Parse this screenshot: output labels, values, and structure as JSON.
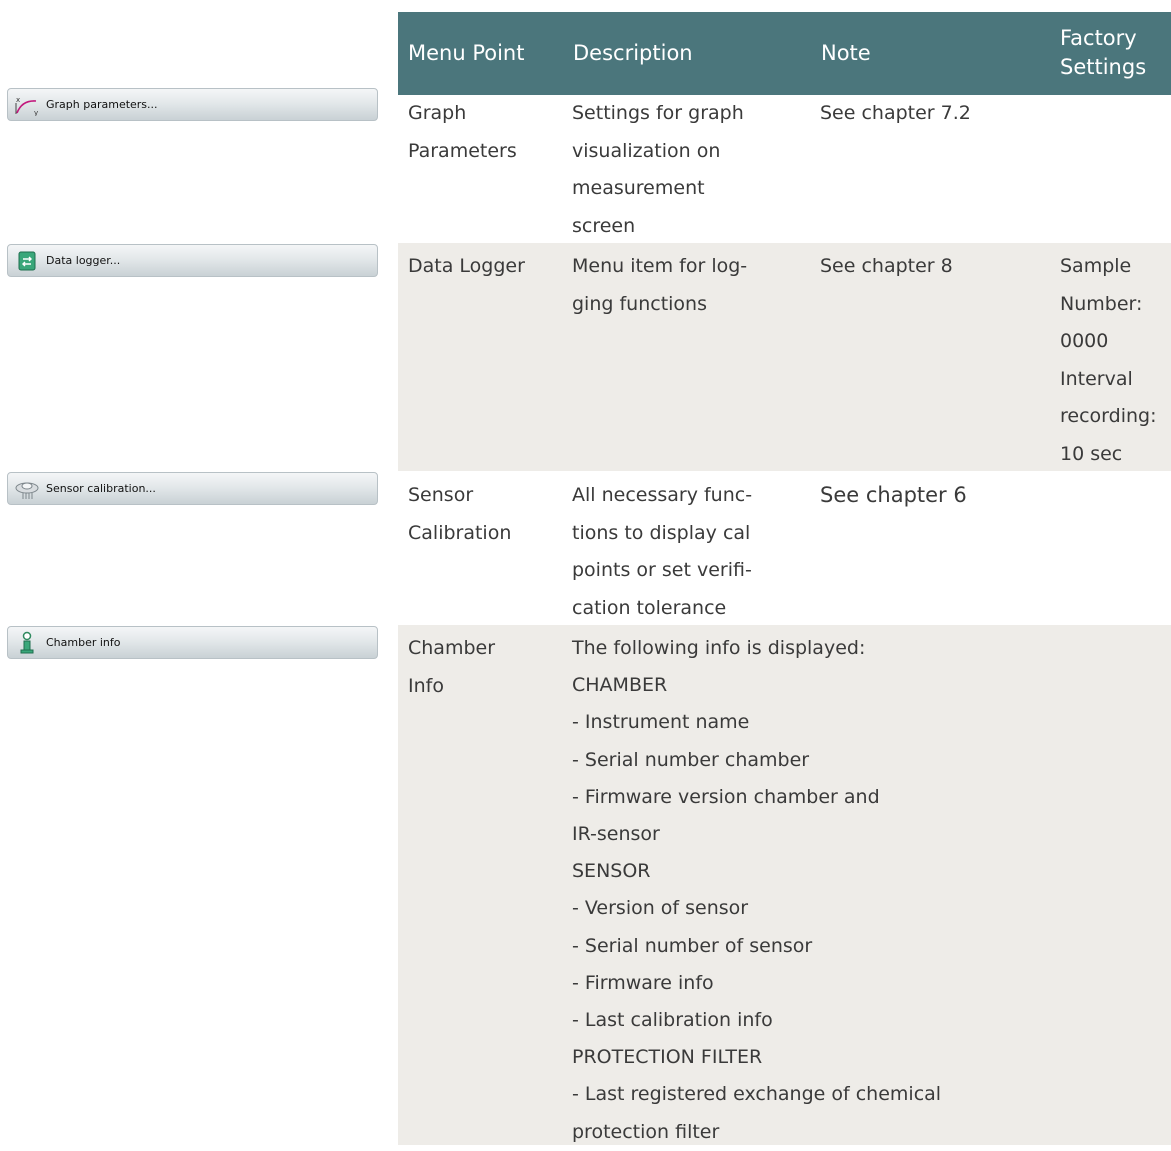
{
  "header": {
    "menu_point": "Menu Point",
    "description": "Description",
    "note": "Note",
    "factory_line1": "Factory",
    "factory_line2": "Settings"
  },
  "menu_buttons": {
    "graph": "Graph parameters...",
    "logger": "Data logger...",
    "calibration": "Sensor calibration...",
    "chamber": "Chamber info"
  },
  "rows": {
    "graph": {
      "menu_point": [
        "Graph",
        "Parameters"
      ],
      "description": [
        "Settings for graph",
        "visualization on",
        "measurement",
        "screen"
      ],
      "note": "See chapter 7.2"
    },
    "logger": {
      "menu_point": [
        "Data Logger"
      ],
      "description": [
        "Menu item for log-",
        "ging functions"
      ],
      "note": "See chapter 8",
      "factory": [
        "Sample",
        "Number:",
        "0000",
        "Interval",
        "recording:",
        "10 sec"
      ]
    },
    "calibration": {
      "menu_point": [
        "Sensor",
        "Calibration"
      ],
      "description": [
        "All necessary func-",
        "tions to display cal",
        "points or set verifi-",
        "cation tolerance"
      ],
      "note": "See chapter 6"
    },
    "chamber": {
      "menu_point": [
        "Chamber",
        "Info"
      ],
      "description": [
        "The following info is displayed:",
        "CHAMBER",
        "- Instrument name",
        "- Serial number chamber",
        "- Firmware version chamber and",
        "IR-sensor",
        "SENSOR",
        "- Version of sensor",
        "- Serial number of sensor",
        "- Firmware info",
        "- Last calibration info",
        "PROTECTION FILTER",
        "- Last registered exchange of chemical",
        "protection filter"
      ]
    }
  },
  "colors": {
    "header_bg": "#4b767c",
    "band_gray": "#eeece8",
    "text": "#3a3a3a"
  },
  "icons": {
    "graph": "graph-xy-icon",
    "logger": "data-logger-icon",
    "calibration": "sensor-icon",
    "chamber": "info-icon"
  }
}
